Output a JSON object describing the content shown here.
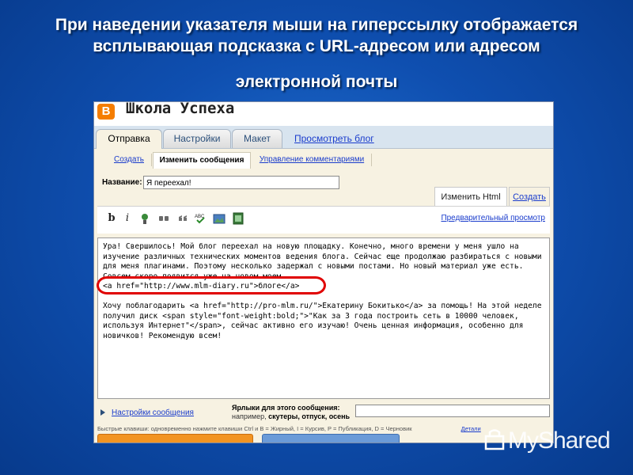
{
  "slide": {
    "title_line1": "При наведении указателя мыши на гиперссылку отображается",
    "title_line2": "всплывающая подсказка с URL-адресом или адресом",
    "title_line3": "электронной почты"
  },
  "blog": {
    "icon": "blogger-icon",
    "name": "Школа Успеха"
  },
  "main_tabs": [
    {
      "label": "Отправка",
      "active": true
    },
    {
      "label": "Настройки",
      "active": false
    },
    {
      "label": "Макет",
      "active": false
    }
  ],
  "view_blog_link": "Просмотреть блог",
  "sub_tabs": [
    {
      "label": "Создать",
      "active": false
    },
    {
      "label": "Изменить сообщения",
      "active": true
    },
    {
      "label": "Управление комментариями",
      "active": false
    }
  ],
  "post": {
    "title_label": "Название:",
    "title_value": "Я переехал!"
  },
  "editor_tabs": {
    "html_label": "Изменить Html",
    "compose_label": "Создать"
  },
  "toolbar": {
    "bold": "b",
    "italic": "i",
    "preview_label": "Предварительный просмотр"
  },
  "editor": {
    "para1": "Ура! Свершилось! Мой блог переехал на новую площадку. Конечно, много времени у меня ушло на изучение различных технических моментов ведения блога. Сейчас еще продолжаю разбираться с новыми для меня плагинами. Поэтому несколько задержал с новыми постами. Но новый материал уже есть. Совсем скоро появится уже на новом моем",
    "para1_link": "<a href=\"http://www.mlm-diary.ru\">блоге</a>",
    "para2": "Хочу поблагодарить <a href=\"http://pro-mlm.ru/\">Екатерину Бокитько</a> за помощь! На этой неделе получил диск <span style=\"font-weight:bold;\">\"Как за 3 года построить сеть в 10000 человек, используя Интернет\"</span>, сейчас активно его изучаю! Очень ценная информация, особенно для новичков! Рекомендую всем!"
  },
  "bottom": {
    "settings_link": "Настройки сообщения",
    "labels_label": "Ярлыки для этого сообщения:",
    "labels_hint_prefix": "например, ",
    "labels_hint_values": "скутеры, отпуск, осень"
  },
  "shortcuts": {
    "text": "Быстрые клавиши: одновременно нажмите клавиши Ctrl и B = Жирный, I = Курсив, P = Публикация, D = Черновик",
    "more": "Детали"
  },
  "watermark": {
    "text": "MyShared"
  },
  "colors": {
    "slide_bg": "#0f4fb0",
    "panel_bg": "#f7f2e2",
    "link": "#1a3ccc",
    "highlight": "#e00000",
    "publish_button": "#f29422",
    "save_button": "#6b9bd8"
  }
}
